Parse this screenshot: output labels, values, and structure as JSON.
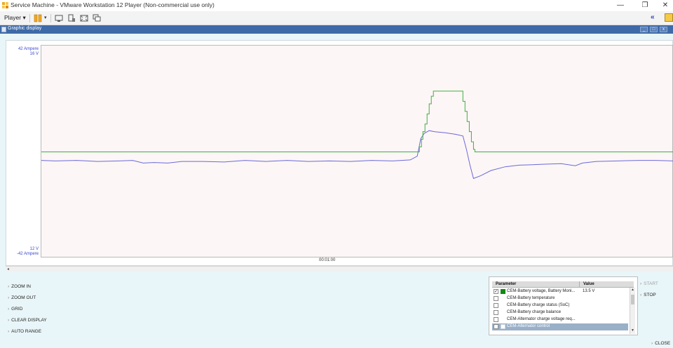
{
  "window": {
    "title": "Service Machine - VMware Workstation 12 Player (Non-commercial use only)",
    "minimize": "—",
    "restore": "❐",
    "close": "✕"
  },
  "toolbar": {
    "player_label": "Player ▾",
    "collapse_icon": "«"
  },
  "inner_window": {
    "title": "Graphic display",
    "min": "_",
    "max": "□",
    "close": "x"
  },
  "plot": {
    "y_top_primary": "42 Ampere",
    "y_top_secondary": "16 V",
    "y_bottom_secondary": "12 V",
    "y_bottom_primary": "-42 Ampere",
    "time_label": "00:01:00"
  },
  "colors": {
    "voltage_series": "#6a6ad8",
    "control_series": "#3fae3f",
    "accent_blue": "#3e6aa8",
    "swatch_green": "#138a13"
  },
  "chart_data": {
    "type": "line",
    "x_label": "00:01:00",
    "y_left_range": [
      "-42 Ampere",
      "42 Ampere"
    ],
    "y_right_range": [
      "12 V",
      "16 V"
    ],
    "ylim_volts": [
      12,
      16
    ],
    "series": [
      {
        "name": "CEM-Battery voltage, Battery Moni...",
        "color": "#6a6ad8",
        "unit": "V",
        "points": [
          [
            0,
            13.84
          ],
          [
            20,
            13.83
          ],
          [
            50,
            13.84
          ],
          [
            80,
            13.82
          ],
          [
            110,
            13.83
          ],
          [
            130,
            13.84
          ],
          [
            145,
            13.79
          ],
          [
            160,
            13.8
          ],
          [
            180,
            13.79
          ],
          [
            200,
            13.82
          ],
          [
            230,
            13.82
          ],
          [
            260,
            13.81
          ],
          [
            290,
            13.84
          ],
          [
            320,
            13.82
          ],
          [
            350,
            13.84
          ],
          [
            380,
            13.82
          ],
          [
            410,
            13.83
          ],
          [
            440,
            13.82
          ],
          [
            470,
            13.84
          ],
          [
            500,
            13.83
          ],
          [
            525,
            13.85
          ],
          [
            535,
            13.92
          ],
          [
            540,
            14.25
          ],
          [
            545,
            14.35
          ],
          [
            552,
            14.4
          ],
          [
            560,
            14.38
          ],
          [
            575,
            14.36
          ],
          [
            590,
            14.33
          ],
          [
            600,
            14.3
          ],
          [
            605,
            14.05
          ],
          [
            610,
            13.75
          ],
          [
            615,
            13.5
          ],
          [
            625,
            13.55
          ],
          [
            640,
            13.65
          ],
          [
            660,
            13.72
          ],
          [
            680,
            13.75
          ],
          [
            700,
            13.76
          ],
          [
            720,
            13.77
          ],
          [
            740,
            13.78
          ],
          [
            760,
            13.74
          ],
          [
            770,
            13.79
          ],
          [
            790,
            13.82
          ],
          [
            820,
            13.83
          ],
          [
            850,
            13.84
          ],
          [
            875,
            13.84
          ],
          [
            900,
            13.83
          ]
        ]
      },
      {
        "name": "CEM-Alternator control",
        "color": "#3fae3f",
        "unit": "A",
        "points": [
          [
            0,
            0
          ],
          [
            536,
            0
          ],
          [
            538,
            2
          ],
          [
            541,
            5
          ],
          [
            543,
            8
          ],
          [
            546,
            11
          ],
          [
            549,
            15
          ],
          [
            552,
            19
          ],
          [
            555,
            22
          ],
          [
            558,
            24
          ],
          [
            563,
            24
          ],
          [
            565,
            24
          ],
          [
            588,
            24
          ],
          [
            590,
            24
          ],
          [
            598,
            24
          ],
          [
            600,
            20
          ],
          [
            603,
            16
          ],
          [
            606,
            12
          ],
          [
            609,
            8
          ],
          [
            612,
            4
          ],
          [
            615,
            1
          ],
          [
            617,
            0
          ],
          [
            625,
            0
          ],
          [
            900,
            0
          ]
        ]
      }
    ],
    "grid": false,
    "legend": "none"
  },
  "left_menu": [
    {
      "label": "ZOOM IN"
    },
    {
      "label": "ZOOM OUT"
    },
    {
      "label": "GRID"
    },
    {
      "label": "CLEAR DISPLAY"
    },
    {
      "label": "AUTO RANGE"
    }
  ],
  "param_table": {
    "header_parameter": "Parameter",
    "header_value": "Value",
    "rows": [
      {
        "checked": true,
        "swatch": "#138a13",
        "name": "CEM-Battery voltage, Battery Moni...",
        "value": "13.5 V"
      },
      {
        "checked": false,
        "swatch": "",
        "name": "CEM-Battery temperature",
        "value": ""
      },
      {
        "checked": false,
        "swatch": "",
        "name": "CEM-Battery charge status (SoC)",
        "value": ""
      },
      {
        "checked": false,
        "swatch": "",
        "name": "CEM-Battery charge balance",
        "value": ""
      },
      {
        "checked": false,
        "swatch": "",
        "name": "CEM-Alternator charge voltage req...",
        "value": ""
      },
      {
        "checked": false,
        "swatch": "",
        "name": "CEM-Alternator control",
        "value": "",
        "selected": true
      }
    ]
  },
  "side_commands": {
    "start": "START",
    "stop": "STOP",
    "close": "CLOSE"
  }
}
